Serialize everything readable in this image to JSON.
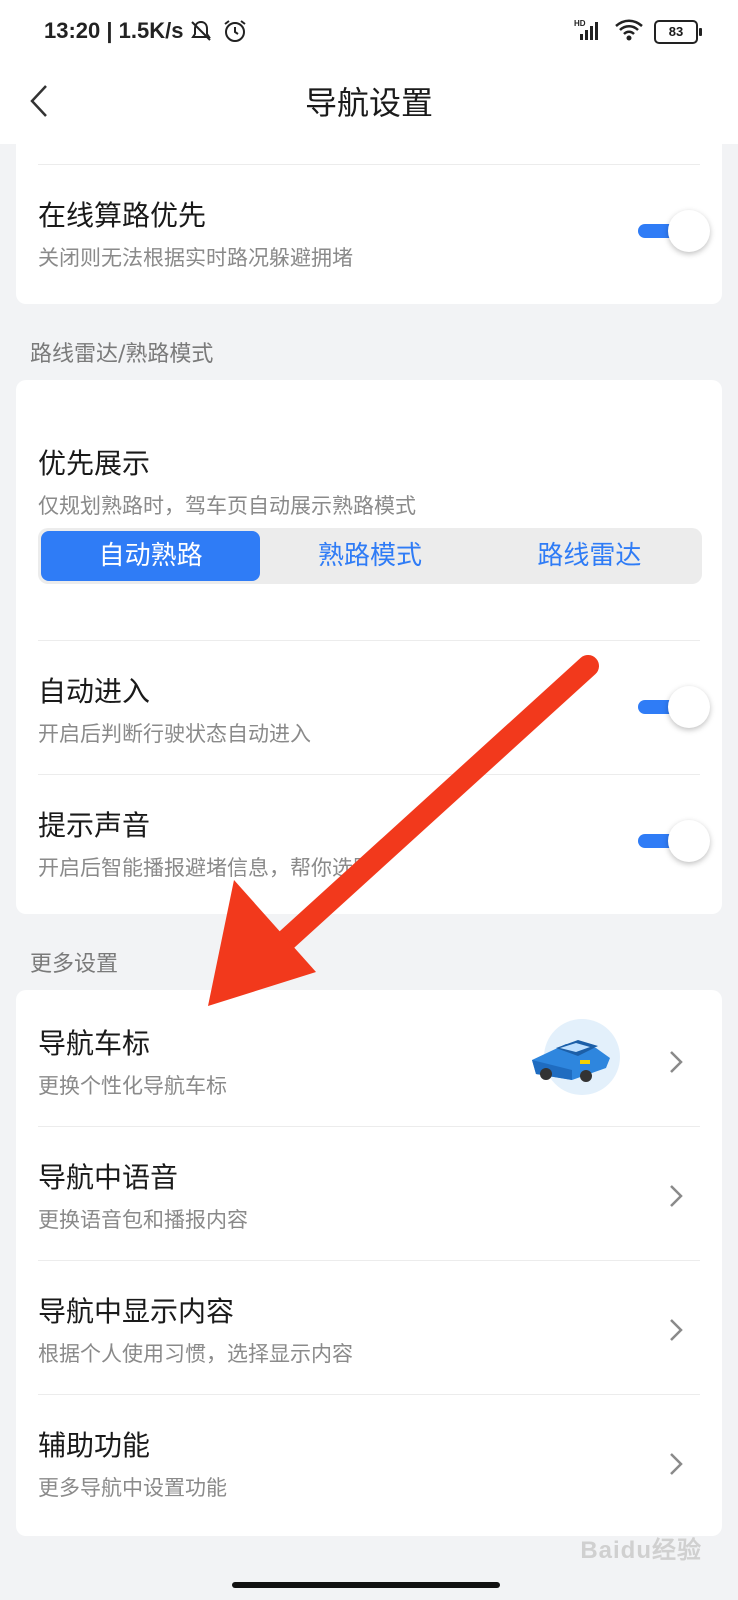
{
  "status_bar": {
    "time_and_speed": "13:20 | 1.5K/s",
    "battery": "83",
    "icons": [
      "mute-icon",
      "alarm-icon",
      "hd-signal-icon",
      "wifi-icon",
      "battery-icon"
    ]
  },
  "header": {
    "title": "导航设置",
    "back_icon": "chevron-left-icon"
  },
  "online_route": {
    "title": "在线算路优先",
    "subtitle": "关闭则无法根据实时路况躲避拥堵",
    "enabled": true
  },
  "route_radar_section": {
    "label": "路线雷达/熟路模式",
    "priority": {
      "title": "优先展示",
      "subtitle": "仅规划熟路时，驾车页自动展示熟路模式",
      "options": [
        "自动熟路",
        "熟路模式",
        "路线雷达"
      ],
      "selected": "自动熟路"
    },
    "auto_enter": {
      "title": "自动进入",
      "subtitle": "开启后判断行驶状态自动进入",
      "enabled": true
    },
    "sound": {
      "title": "提示声音",
      "subtitle": "开启后智能播报避堵信息，帮你选路",
      "enabled": true
    }
  },
  "more_section": {
    "label": "更多设置",
    "items": [
      {
        "title": "导航车标",
        "subtitle": "更换个性化导航车标"
      },
      {
        "title": "导航中语音",
        "subtitle": "更换语音包和播报内容"
      },
      {
        "title": "导航中显示内容",
        "subtitle": "根据个人使用习惯，选择显示内容"
      },
      {
        "title": "辅助功能",
        "subtitle": "更多导航中设置功能"
      }
    ]
  },
  "watermark": "Baidu经验",
  "colors": {
    "accent": "#2f7cf6",
    "annotation_arrow": "#f2391c",
    "background": "#f2f3f5"
  }
}
